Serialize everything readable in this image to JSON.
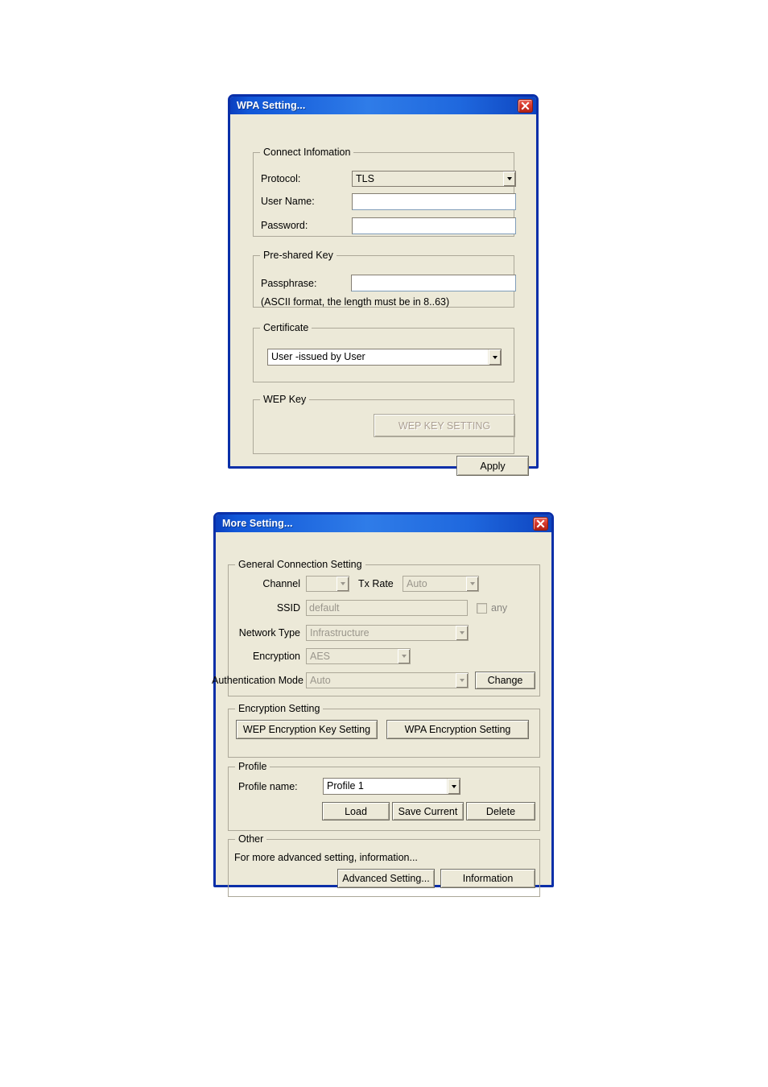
{
  "page": {
    "background": "#ffffff"
  },
  "theme": {
    "title_blue": "#1157d8",
    "border_blue": "#0a2fa8",
    "face": "#ece9d8",
    "disabled_text": "#9a968c"
  },
  "wpa_dialog": {
    "title": "WPA Setting...",
    "close_icon": "close-icon",
    "connect_information": {
      "legend": "Connect Infomation",
      "protocol_label": "Protocol:",
      "protocol_value": "TLS",
      "protocol_options": [
        "TLS"
      ],
      "user_name_label": "User Name:",
      "user_name_value": "",
      "password_label": "Password:",
      "password_value": ""
    },
    "pre_shared_key": {
      "legend": "Pre-shared Key",
      "passphrase_label": "Passphrase:",
      "passphrase_value": "",
      "hint": "(ASCII format, the length must be in 8..63)"
    },
    "certificate": {
      "legend": "Certificate",
      "value": "User -issued by User",
      "options": [
        "User -issued by User"
      ]
    },
    "wep_key": {
      "legend": "WEP Key",
      "button_label": "WEP KEY SETTING",
      "button_enabled": false
    },
    "apply_label": "Apply"
  },
  "more_dialog": {
    "title": "More Setting...",
    "close_icon": "close-icon",
    "general": {
      "legend": "General Connection Setting",
      "channel_label": "Channel",
      "channel_value": "",
      "tx_rate_label": "Tx Rate",
      "tx_rate_value": "Auto",
      "ssid_label": "SSID",
      "ssid_value": "default",
      "any_label": "any",
      "any_checked": false,
      "network_type_label": "Network Type",
      "network_type_value": "Infrastructure",
      "encryption_label": "Encryption",
      "encryption_value": "AES",
      "auth_mode_label": "Authentication Mode",
      "auth_mode_value": "Auto",
      "change_label": "Change"
    },
    "encryption_setting": {
      "legend": "Encryption Setting",
      "wep_button": "WEP Encryption Key Setting",
      "wpa_button": "WPA Encryption Setting"
    },
    "profile": {
      "legend": "Profile",
      "name_label": "Profile name:",
      "name_value": "Profile 1",
      "options": [
        "Profile 1"
      ],
      "load_label": "Load",
      "save_label": "Save Current",
      "delete_label": "Delete"
    },
    "other": {
      "legend": "Other",
      "text": "For more advanced setting, information...",
      "advanced_label": "Advanced Setting...",
      "information_label": "Information"
    }
  }
}
